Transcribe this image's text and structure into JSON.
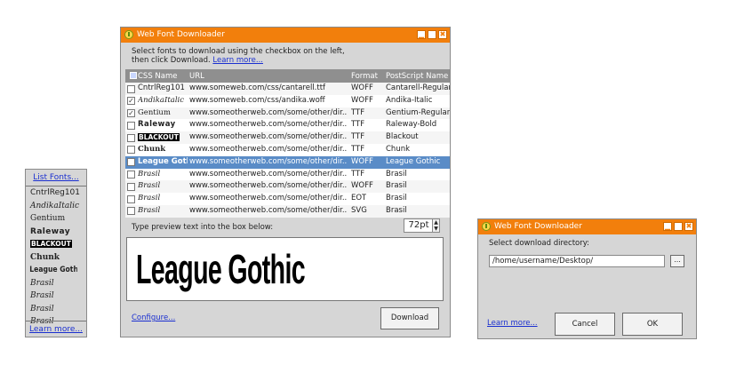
{
  "font_list": {
    "list_fonts_link": "List Fonts...",
    "items": [
      "CntrlReg101",
      "AndikaItalic",
      "Gentium",
      "Raleway",
      "BLACKOUT",
      "Chunk",
      "League Gothic",
      "Brasil",
      "Brasil",
      "Brasil",
      "Brasil"
    ],
    "learn_more_link": "Learn more..."
  },
  "main_window": {
    "title": "Web Font Downloader",
    "intro_line1": "Select fonts to download using the checkbox on the left,",
    "intro_line2": "then click Download.",
    "learn_more_link": "Learn more...",
    "columns": {
      "name": "CSS Name",
      "url": "URL",
      "format": "Format",
      "postscript": "PostScript Name"
    },
    "rows": [
      {
        "name": "CntrlReg101",
        "url": "www.someweb.com/css/cantarell.ttf",
        "format": "WOFF",
        "postscript": "Cantarell-Regular",
        "checked": false,
        "selected": false
      },
      {
        "name": "AndikaItalic",
        "url": "www.someweb.com/css/andika.woff",
        "format": "WOFF",
        "postscript": "Andika-Italic",
        "checked": true,
        "selected": false
      },
      {
        "name": "Gentium",
        "url": "www.someotherweb.com/some/other/dir...",
        "format": "TTF",
        "postscript": "Gentium-Regular",
        "checked": true,
        "selected": false
      },
      {
        "name": "Raleway",
        "url": "www.someotherweb.com/some/other/dir...",
        "format": "TTF",
        "postscript": "Raleway-Bold",
        "checked": false,
        "selected": false
      },
      {
        "name": "BLACKOUT",
        "url": "www.someotherweb.com/some/other/dir...",
        "format": "TTF",
        "postscript": "Blackout",
        "checked": false,
        "selected": false
      },
      {
        "name": "Chunk",
        "url": "www.someotherweb.com/some/other/dir...",
        "format": "TTF",
        "postscript": "Chunk",
        "checked": false,
        "selected": false
      },
      {
        "name": "League Gothic",
        "url": "www.someotherweb.com/some/other/dir...",
        "format": "WOFF",
        "postscript": "League Gothic",
        "checked": false,
        "selected": true
      },
      {
        "name": "Brasil",
        "url": "www.someotherweb.com/some/other/dir...",
        "format": "TTF",
        "postscript": "Brasil",
        "checked": false,
        "selected": false
      },
      {
        "name": "Brasil",
        "url": "www.someotherweb.com/some/other/dir...",
        "format": "WOFF",
        "postscript": "Brasil",
        "checked": false,
        "selected": false
      },
      {
        "name": "Brasil",
        "url": "www.someotherweb.com/some/other/dir...",
        "format": "EOT",
        "postscript": "Brasil",
        "checked": false,
        "selected": false
      },
      {
        "name": "Brasil",
        "url": "www.someotherweb.com/some/other/dir...",
        "format": "SVG",
        "postscript": "Brasil",
        "checked": false,
        "selected": false
      }
    ],
    "preview_label": "Type preview text into the box below:",
    "preview_size": "72pt",
    "preview_text": "League Gothic",
    "configure_link": "Configure...",
    "download_label": "Download"
  },
  "dialog": {
    "title": "Web Font Downloader",
    "label": "Select download directory:",
    "path": "/home/username/Desktop/",
    "browse_label": "...",
    "learn_more_link": "Learn more...",
    "cancel_label": "Cancel",
    "ok_label": "OK"
  },
  "colors": {
    "titlebar": "#f27f0c",
    "selected_row": "#5a8cc7",
    "header": "#8f8f8f",
    "panel": "#d6d6d6",
    "link": "#1a2fd0"
  },
  "icons": {
    "app": "app-icon",
    "minimize": "minimize-icon",
    "maximize": "maximize-icon",
    "close": "close-icon"
  }
}
